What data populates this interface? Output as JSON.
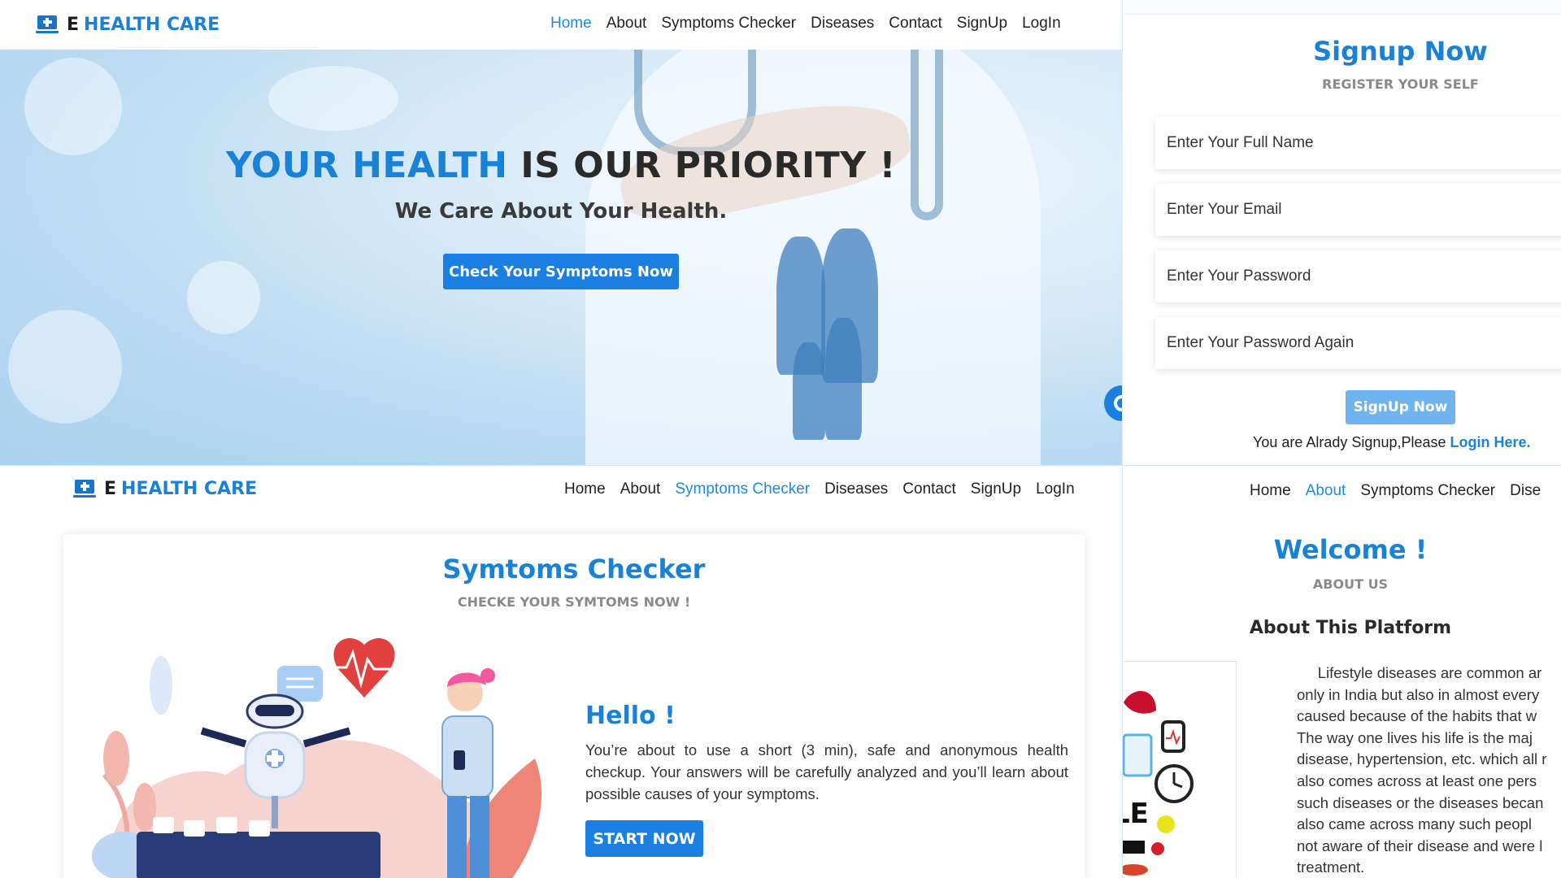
{
  "brand": {
    "letter": "E",
    "name": "HEALTH CARE"
  },
  "nav_items": [
    "Home",
    "About",
    "Symptoms Checker",
    "Diseases",
    "Contact",
    "SignUp",
    "LogIn"
  ],
  "home": {
    "active_nav": "Home",
    "hero_title_blue": "YOUR HEALTH",
    "hero_title_dark": "IS OUR PRIORITY !",
    "hero_subtitle": "We Care About Your Health.",
    "hero_button": "Check Your Symptoms Now"
  },
  "signup": {
    "title": "Signup Now",
    "subtitle": "REGISTER YOUR SELF",
    "fields": [
      "Enter Your Full Name",
      "Enter Your Email",
      "Enter Your Password",
      "Enter Your Password Again"
    ],
    "button": "SignUp Now",
    "note": "You are Alrady Signup,Please ",
    "login_link": "Login Here."
  },
  "checker": {
    "active_nav": "Symptoms Checker",
    "title": "Symtoms Checker",
    "subtitle": "CHECKE YOUR SYMTOMS NOW !",
    "hello": "Hello !",
    "description": "You’re about to use a short (3 min), safe and anonymous health checkup. Your answers will be carefully analyzed and you’ll learn about possible causes of your symptoms.",
    "button": "START NOW"
  },
  "about": {
    "nav_items": [
      "Home",
      "About",
      "Symptoms Checker",
      "Dise"
    ],
    "active_nav": "About",
    "title": "Welcome !",
    "subtitle": "ABOUT US",
    "heading": "About This Platform",
    "image_word": "LE",
    "lines": [
      "     Lifestyle diseases are common ar",
      "only in India but also in almost every",
      "caused because of the habits that w",
      "The way one lives his life is the maj",
      "disease, hypertension, etc. which all r",
      "also comes across at least one pers",
      "such diseases or the diseases becan",
      "also came across many such peopl",
      "not aware of their disease and were l",
      "treatment."
    ]
  },
  "colors": {
    "accent": "#1a82d6",
    "button": "#1a7fe0",
    "button_light": "#6fb3ef",
    "muted": "#8a8a8a"
  },
  "icons": [
    "laptop-medical-icon",
    "chat-icon"
  ]
}
